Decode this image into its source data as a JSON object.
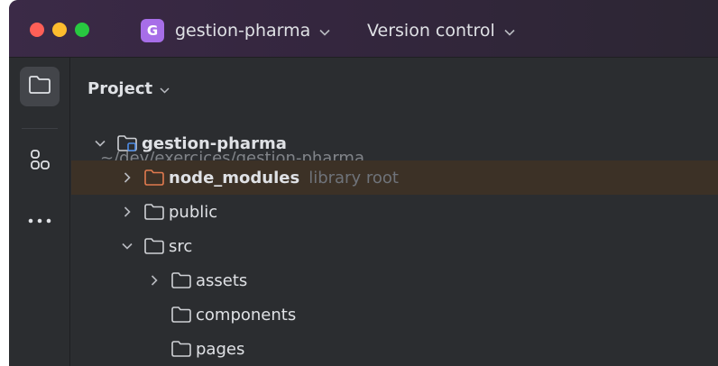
{
  "titlebar": {
    "project_badge": "G",
    "project_name": "gestion-pharma",
    "vcs_label": "Version control",
    "dropdown_icon": "chevron-down-icon"
  },
  "rail": {
    "items": [
      {
        "icon": "folder-icon",
        "active": true
      },
      {
        "icon": "structure-icon",
        "active": false
      },
      {
        "icon": "more-icon",
        "active": false
      }
    ]
  },
  "panel": {
    "title": "Project"
  },
  "tree": [
    {
      "label": "gestion-pharma",
      "hint": "~/dev/exercices/gestion-pharma",
      "expanded": true,
      "depth": 0,
      "icon": "module-folder-icon"
    },
    {
      "label": "node_modules",
      "hint": "library root",
      "expanded": false,
      "depth": 1,
      "icon": "excluded-folder-icon"
    },
    {
      "label": "public",
      "hint": "",
      "expanded": false,
      "depth": 1,
      "icon": "folder-icon"
    },
    {
      "label": "src",
      "hint": "",
      "expanded": true,
      "depth": 1,
      "icon": "folder-icon"
    },
    {
      "label": "assets",
      "hint": "",
      "expanded": false,
      "depth": 2,
      "icon": "folder-icon"
    },
    {
      "label": "components",
      "hint": "",
      "expanded": null,
      "depth": 2,
      "icon": "folder-icon"
    },
    {
      "label": "pages",
      "hint": "",
      "expanded": null,
      "depth": 2,
      "icon": "folder-icon"
    }
  ],
  "colors": {
    "accent_badge": "#a76ee8",
    "selection_row": "#3c3126",
    "library_folder": "#e07a4f"
  }
}
